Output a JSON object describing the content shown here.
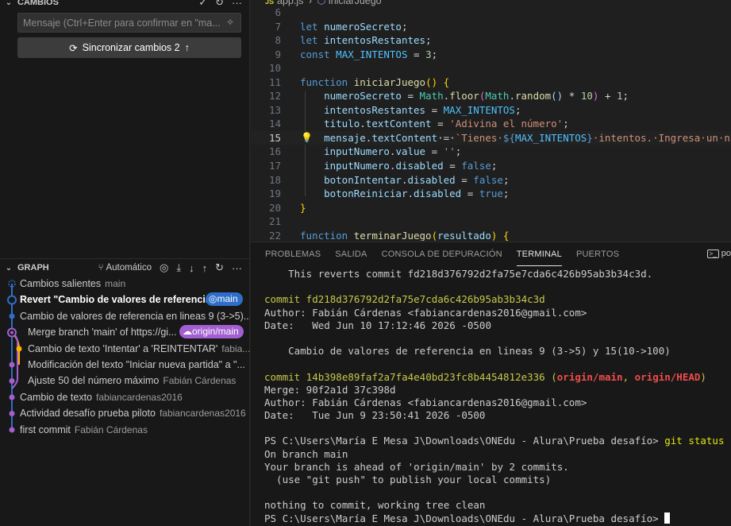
{
  "scm": {
    "changes_title": "CAMBIOS",
    "commit_placeholder": "Mensaje (Ctrl+Enter para confirmar en \"ma...",
    "sync_label": "Sincronizar cambios 2"
  },
  "graph": {
    "title": "GRAPH",
    "auto_label": "Automático",
    "rows": [
      {
        "message": "Cambios salientes",
        "author": "main",
        "badge": ""
      },
      {
        "message": "Revert \"Cambio de valores de referencia ...",
        "author": "",
        "badge": "main"
      },
      {
        "message": "Cambio de valores de referencia en lineas 9 (3->5)...",
        "author": "",
        "badge": ""
      },
      {
        "message": "Merge branch 'main' of https://gi...",
        "author": "",
        "badge": "origin/main"
      },
      {
        "message": "Cambio de texto 'Intentar' a 'REINTENTAR'",
        "author": "fabia...",
        "badge": ""
      },
      {
        "message": "Modificación del texto \"Iniciar nueva partida\" a \"...",
        "author": "",
        "badge": ""
      },
      {
        "message": "Ajuste 50 del número máximo",
        "author": "Fabián Cárdenas",
        "badge": ""
      },
      {
        "message": "Cambio de texto",
        "author": "fabiancardenas2016",
        "badge": ""
      },
      {
        "message": "Actividad desafío prueba piloto",
        "author": "fabiancardenas2016",
        "badge": ""
      },
      {
        "message": "first commit",
        "author": "Fabián Cárdenas",
        "badge": ""
      }
    ]
  },
  "editor": {
    "file": "app.js",
    "symbol": "iniciarJuego",
    "line_numbers": [
      "6",
      "7",
      "8",
      "9",
      "10",
      "11",
      "12",
      "13",
      "14",
      "15",
      "16",
      "17",
      "18",
      "19",
      "20",
      "21",
      "22"
    ]
  },
  "panel": {
    "tabs": [
      "PROBLEMAS",
      "SALIDA",
      "CONSOLA DE DEPURACIÓN",
      "TERMINAL",
      "PUERTOS"
    ],
    "active_tab": "TERMINAL",
    "right_label": "po",
    "terminal": {
      "revert_line": "    This reverts commit fd218d376792d2fa75e7cda6c426b95ab3b34c3d.",
      "c1_commit": "commit fd218d376792d2fa75e7cda6c426b95ab3b34c3d",
      "c1_author": "Author: Fabián Cárdenas <fabiancardenas2016@gmail.com>",
      "c1_date": "Date:   Wed Jun 10 17:12:46 2026 -0500",
      "c1_msg": "    Cambio de valores de referencia en lineas 9 (3->5) y 15(10->100)",
      "c2_commit": "commit 14b398e89faf2a7fa4e40bd23fc8b4454812e336 ",
      "c2_ref_open": "(",
      "c2_ref1": "origin/main",
      "c2_sep": ", ",
      "c2_ref2": "origin/HEAD",
      "c2_ref_close": ")",
      "c2_merge": "Merge: 90f2a1d 37c398d",
      "c2_author": "Author: Fabián Cárdenas <fabiancardenas2016@gmail.com>",
      "c2_date": "Date:   Tue Jun 9 23:50:41 2026 -0500",
      "ps_prompt": "PS C:\\Users\\María E Mesa J\\Downloads\\ONEdu - Alura\\Prueba desafío> ",
      "ps_cmd": "git status",
      "status1": "On branch main",
      "status2": "Your branch is ahead of 'origin/main' by 2 commits.",
      "status3": "  (use \"git push\" to publish your local commits)",
      "status4": "nothing to commit, working tree clean",
      "ps_prompt2": "PS C:\\Users\\María E Mesa J\\Downloads\\ONEdu - Alura\\Prueba desafío> "
    }
  }
}
